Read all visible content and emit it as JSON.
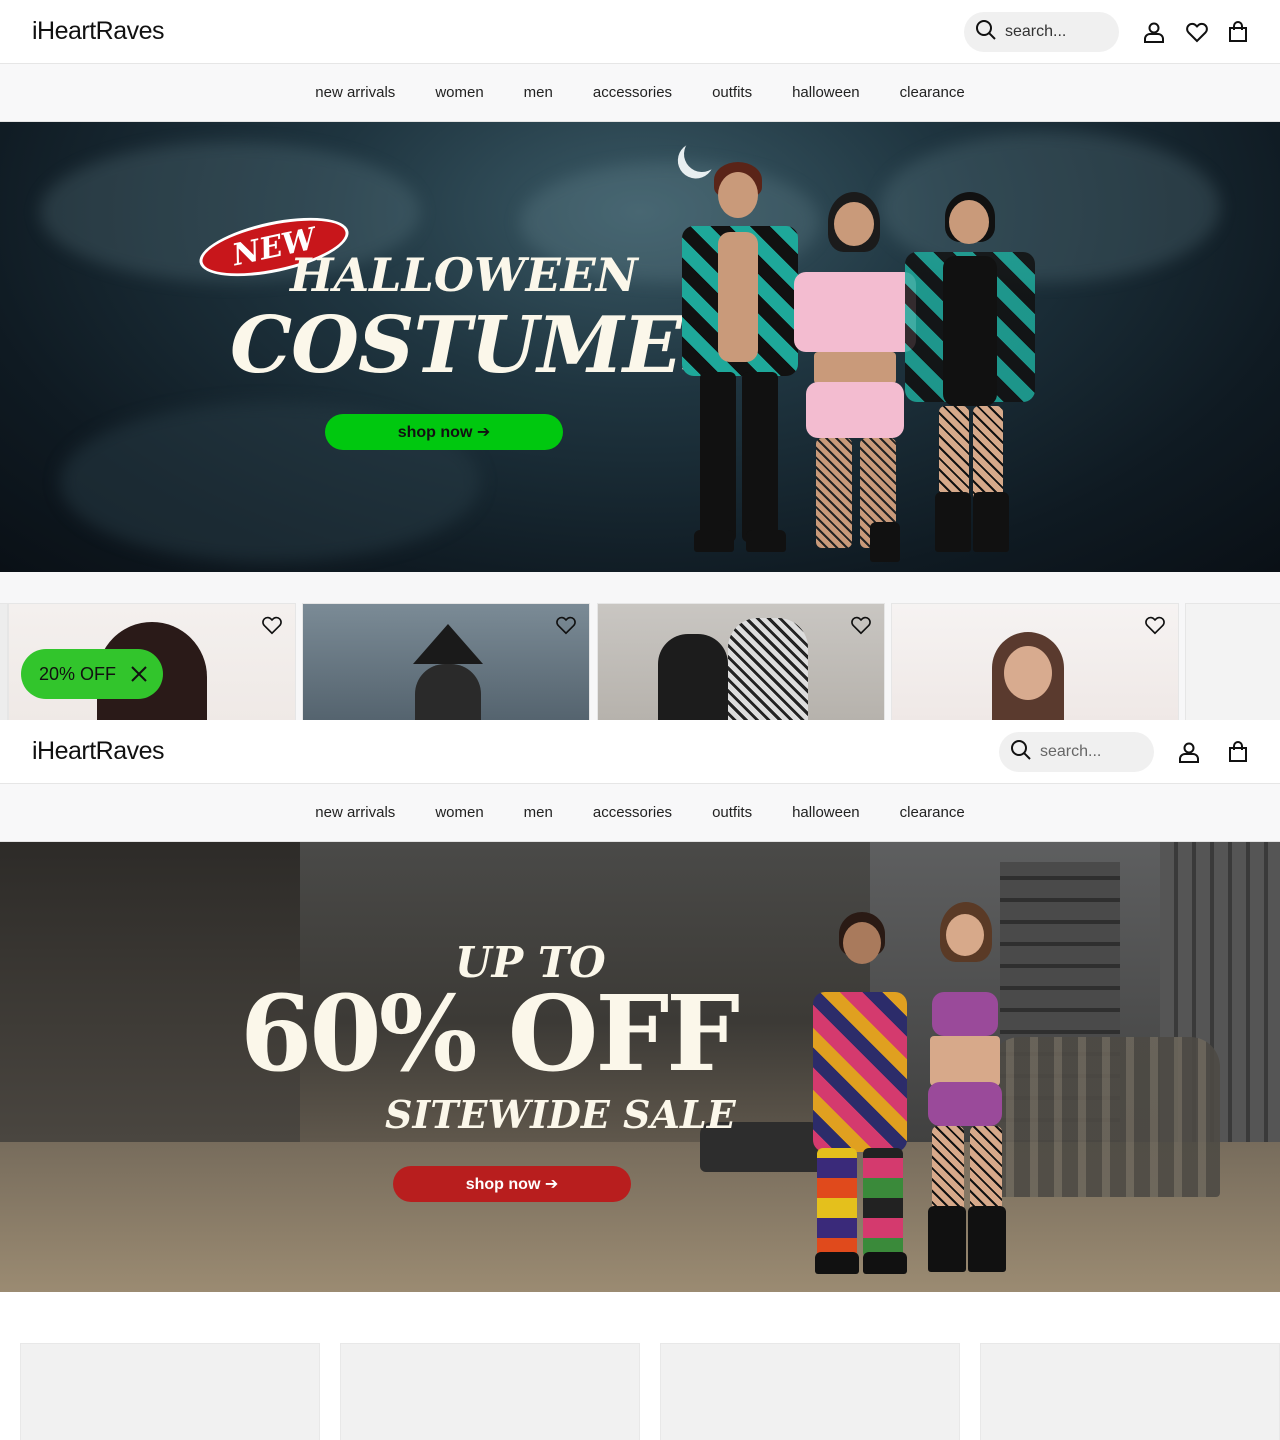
{
  "brand": {
    "logo_text": "iHeartRaves"
  },
  "search": {
    "placeholder": "search..."
  },
  "nav": [
    "new arrivals",
    "women",
    "men",
    "accessories",
    "outfits",
    "halloween",
    "clearance"
  ],
  "hero_halloween": {
    "badge": "NEW",
    "line1": "HALLOWEEN",
    "line2": "COSTUMES",
    "cta": "shop now ➔",
    "cta_color": "#00c80f"
  },
  "hero_sale": {
    "line1": "UP TO",
    "line2": "60% OFF",
    "line3": "SITEWIDE SALE",
    "cta": "shop now ➔",
    "cta_color": "#b81e1e"
  },
  "promo": {
    "label": "20% OFF",
    "accent": "#32c52c"
  },
  "icons": {
    "search": "search-icon",
    "account": "account-icon",
    "wishlist": "heart-icon",
    "cart": "bag-icon",
    "close": "close-icon"
  }
}
